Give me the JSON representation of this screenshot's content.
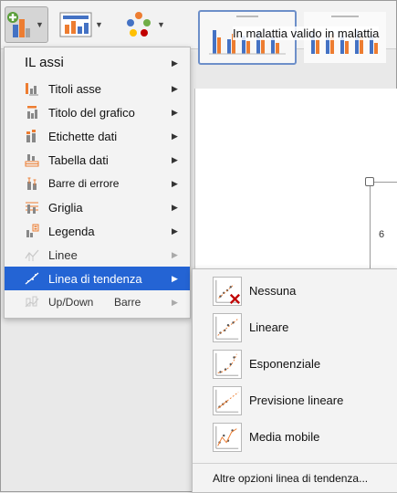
{
  "tooltip": "In malattia valido in malattia",
  "axis_tick": "6",
  "menu": {
    "header": "IL assi",
    "items": [
      {
        "label": "Titoli asse",
        "icon": "axis-titles-icon"
      },
      {
        "label": "Titolo del grafico",
        "icon": "chart-title-icon"
      },
      {
        "label": "Etichette dati",
        "icon": "data-labels-icon"
      },
      {
        "label": "Tabella dati",
        "icon": "data-table-icon"
      },
      {
        "label": "Barre di errore",
        "icon": "error-bars-icon"
      },
      {
        "label": "Griglia",
        "icon": "gridlines-icon"
      },
      {
        "label": "Legenda",
        "icon": "legend-icon"
      },
      {
        "label": "Linee",
        "icon": "lines-icon"
      },
      {
        "label": "Linea di tendenza",
        "icon": "trendline-icon"
      },
      {
        "label": "Up/Down",
        "label2": "Barre",
        "icon": "up-down-bars-icon"
      }
    ]
  },
  "submenu": {
    "items": [
      {
        "label": "Nessuna",
        "icon": "trendline-none-icon"
      },
      {
        "label": "Lineare",
        "icon": "trendline-linear-icon"
      },
      {
        "label": "Esponenziale",
        "icon": "trendline-exponential-icon"
      },
      {
        "label": "Previsione lineare",
        "icon": "trendline-linear-forecast-icon"
      },
      {
        "label": "Media mobile",
        "icon": "trendline-moving-average-icon"
      }
    ],
    "more": "Altre opzioni linea di tendenza..."
  },
  "colors": {
    "accent": "#2464d4",
    "bar_orange": "#ed7d31",
    "bar_blue": "#4472c4",
    "delete_red": "#c00000"
  }
}
